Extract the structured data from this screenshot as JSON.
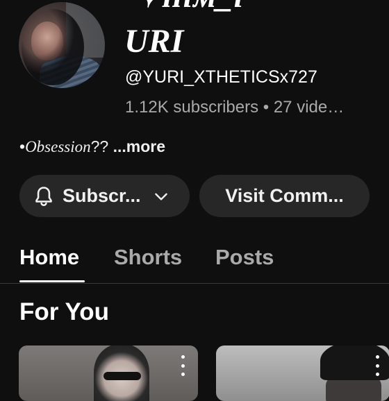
{
  "channel": {
    "title_line1": "·✧ʜɪᴍ_ɪ",
    "title_line2": "URI",
    "handle": "@YURI_XTHETICSx727",
    "stats": "1.12K subscribers • 27 vide…",
    "description_prefix": "•",
    "description_italic": "Obsession",
    "description_suffix": "?? ",
    "more_label": "...more"
  },
  "actions": {
    "subscribe_label": "Subscr...",
    "visit_label": "Visit Comm..."
  },
  "tabs": [
    {
      "label": "Home",
      "active": true
    },
    {
      "label": "Shorts",
      "active": false
    },
    {
      "label": "Posts",
      "active": false
    }
  ],
  "section": {
    "title": "For You"
  },
  "icons": {
    "bell": "bell-icon",
    "chevron": "chevron-down-icon",
    "more": "more-vert-icon"
  },
  "colors": {
    "background": "#0f0f0f",
    "button_bg": "#272727",
    "text_primary": "#f1f1f1",
    "text_secondary": "#aaaaaa"
  }
}
